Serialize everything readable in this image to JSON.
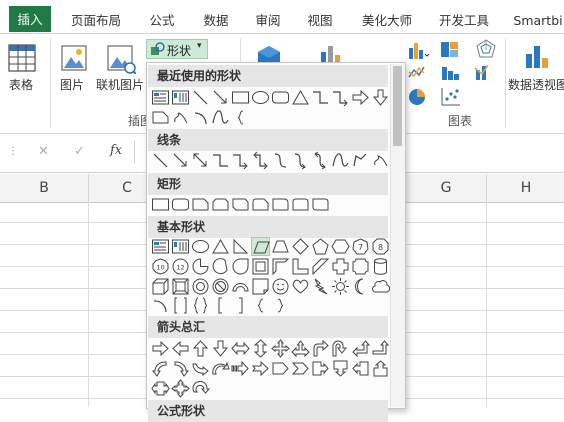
{
  "tabs": [
    {
      "label": "插入",
      "active": true
    },
    {
      "label": "页面布局"
    },
    {
      "label": "公式"
    },
    {
      "label": "数据"
    },
    {
      "label": "审阅"
    },
    {
      "label": "视图"
    },
    {
      "label": "美化大师"
    },
    {
      "label": "开发工具"
    },
    {
      "label": "Smartbi"
    }
  ],
  "ribbon": {
    "table_label": "表格",
    "picture_label": "图片",
    "online_picture_label": "联机图片",
    "shapes_button_label": "形状",
    "pivot_chart_label": "数据透视图",
    "illustrations_group_partial": "插图",
    "charts_group_label": "图表"
  },
  "formula_bar": {
    "fx_label": "fx",
    "cancel_glyph": "✕",
    "enter_glyph": "✓"
  },
  "sheet": {
    "columns": [
      "B",
      "C",
      "G",
      "H"
    ]
  },
  "shapes_menu": {
    "sections": {
      "recent": "最近使用的形状",
      "lines": "线条",
      "rectangles": "矩形",
      "basic": "基本形状",
      "arrows": "箭头总汇",
      "equation_partial": "公式形状"
    }
  },
  "colors": {
    "accent": "#1f7a45",
    "highlight": "#cfe9d6",
    "menu_bg": "#fcfcfc",
    "section_bg": "#e6e6e6"
  }
}
